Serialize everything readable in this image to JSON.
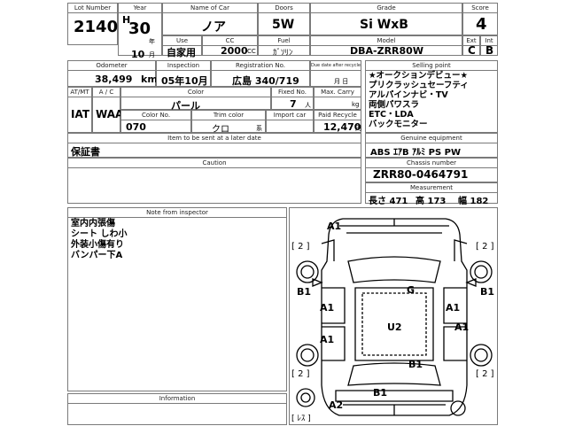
{
  "row1": {
    "lot_number": {
      "label": "Lot Number",
      "value": "2140"
    },
    "year": {
      "label": "Year",
      "era": "H",
      "value": "30",
      "unit": "年",
      "month": "10",
      "month_unit": "月"
    },
    "name": {
      "label": "Name of Car",
      "value": "ノア"
    },
    "doors": {
      "label": "Doors",
      "value": "5W"
    },
    "grade": {
      "label": "Grade",
      "value": "Si WxB"
    },
    "score": {
      "label": "Score",
      "value": "4"
    },
    "use": {
      "label": "Use",
      "value": "自家用"
    },
    "cc": {
      "label": "CC",
      "value": "2000",
      "unit": "CC"
    },
    "fuel": {
      "label": "Fuel",
      "value": "ｶﾞｿﾘﾝ"
    },
    "model": {
      "label": "Model",
      "value": "DBA-ZRR80W"
    },
    "ext": {
      "label": "Ext",
      "value": "C"
    },
    "int": {
      "label": "Int",
      "value": "B"
    }
  },
  "row2": {
    "odometer": {
      "label": "Odometer",
      "value": "38,499",
      "unit": "km"
    },
    "inspection": {
      "label": "Inspection",
      "value": "05年10月"
    },
    "registration": {
      "label": "Registration No.",
      "value": "広島 340/719"
    },
    "due_date": {
      "label": "Due date after recycle charge",
      "value": "月 日"
    },
    "at_mt": {
      "label": "AT/MT",
      "value": "IAT"
    },
    "ac": {
      "label": "A / C",
      "value": "WAA"
    },
    "color": {
      "label": "Color",
      "value": "パール"
    },
    "fixed_no": {
      "label": "Fixed No.",
      "value": "7",
      "unit": "人"
    },
    "max_carry": {
      "label": "Max. Carry",
      "value": "kg"
    },
    "color_no": {
      "label": "Color No.",
      "value": "070"
    },
    "trim_color": {
      "label": "Trim color",
      "value": "クロ",
      "unit": "系"
    },
    "import_car": {
      "label": "Import car",
      "value": ""
    },
    "paid_recycle": {
      "label": "Paid Recycle",
      "value": "12,470",
      "unit": "円"
    }
  },
  "selling_point": {
    "label": "Selling point",
    "lines": [
      "★オークションデビュー★",
      "プリクラッシュセーフティ",
      "アルパインナビ・TV",
      "両側パワスラ",
      "ETC・LDA",
      "バックモニター"
    ]
  },
  "items_later": {
    "label": "Item to be sent at a later date",
    "value": "保証書"
  },
  "genuine": {
    "label": "Genuine equipment",
    "value": "ABS ｴｱB ｱﾙﾐ PS PW"
  },
  "caution": {
    "label": "Caution"
  },
  "chassis": {
    "label": "Chassis number",
    "value": "ZRR80-0464791"
  },
  "measurement": {
    "label": "Measurement",
    "length": "長さ 471",
    "height": "高 173",
    "width": "幅 182"
  },
  "inspector": {
    "label": "Note from inspector",
    "lines": [
      "室内内張傷",
      "シート しわ小",
      "外装小傷有り",
      "バンパー下A"
    ]
  },
  "information": {
    "label": "Information"
  },
  "diagram": {
    "marks": {
      "a1_top": "A1",
      "g": "G",
      "u2": "U2",
      "a1_lf": "A1",
      "a1_lr": "A1",
      "a1_rf": "A1",
      "a1_rr": "A1",
      "b1_l": "B1",
      "b1_r": "B1",
      "b1_rear": "B1",
      "b1_bottom": "B1",
      "a2": "A2",
      "tire_fl": "[ 2 ]",
      "tire_fr": "[ 2 ]",
      "tire_rl": "[ 2 ]",
      "tire_rr": "[ 2 ]",
      "spare": "[ ﾚｽ ]"
    }
  }
}
